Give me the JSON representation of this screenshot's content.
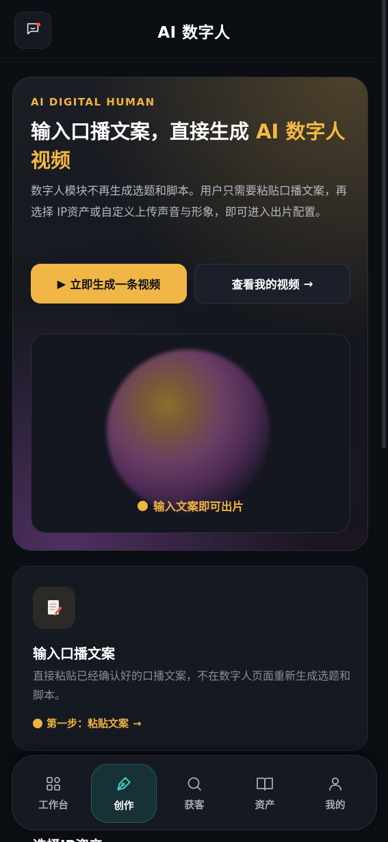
{
  "header": {
    "title": "AI 数字人"
  },
  "hero": {
    "eyebrow": "AI DIGITAL HUMAN",
    "title_main": "输入口播文案，直接生成 ",
    "title_accent": "AI 数字人视频",
    "description": "数字人模块不再生成选题和脚本。用户只需要粘贴口播文案，再选择 IP资产或自定义上传声音与形象，即可进入出片配置。",
    "primary_button": "立即生成一条视频",
    "primary_button_icon": "▶",
    "secondary_button": "查看我的视频",
    "secondary_button_icon": "→",
    "preview_label": "输入文案即可出片"
  },
  "step": {
    "icon": "memo-icon",
    "title": "输入口播文案",
    "description": "直接粘贴已经确认好的口播文案，不在数字人页面重新生成选题和脚本。",
    "link": "第一步：粘贴文案",
    "link_arrow": "→"
  },
  "next_section": {
    "title": "选择IP资产"
  },
  "nav": {
    "items": [
      {
        "label": "工作台",
        "icon": "grid-icon",
        "active": false
      },
      {
        "label": "创作",
        "icon": "pen-icon",
        "active": true
      },
      {
        "label": "获客",
        "icon": "search-icon",
        "active": false
      },
      {
        "label": "资产",
        "icon": "book-icon",
        "active": false
      },
      {
        "label": "我的",
        "icon": "user-icon",
        "active": false
      }
    ]
  },
  "colors": {
    "accent": "#f0b33f",
    "active_nav": "#3fd0c7",
    "background": "#0b0e13"
  }
}
